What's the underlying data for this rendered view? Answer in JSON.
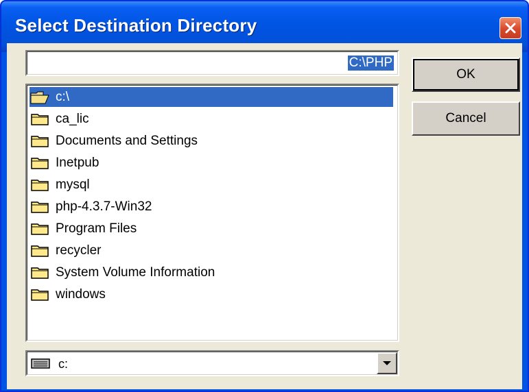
{
  "window": {
    "title": "Select Destination Directory"
  },
  "path_field": {
    "value": "C:\\PHP"
  },
  "buttons": {
    "ok_label": "OK",
    "cancel_label": "Cancel"
  },
  "directory_list": {
    "root": "c:\\",
    "items": [
      "ca_lic",
      "Documents and Settings",
      "Inetpub",
      "mysql",
      "php-4.3.7-Win32",
      "Program Files",
      "recycler",
      "System Volume Information",
      "windows"
    ]
  },
  "drive_select": {
    "value": "c:"
  },
  "icons": {
    "close": "close-icon",
    "open_folder": "open-folder-icon",
    "folder": "folder-icon",
    "drive": "drive-icon",
    "dropdown": "chevron-down-icon"
  },
  "colors": {
    "title_bar": "#0054e3",
    "selection": "#316ac5",
    "close_button": "#d8472b",
    "face": "#ece9d8"
  }
}
